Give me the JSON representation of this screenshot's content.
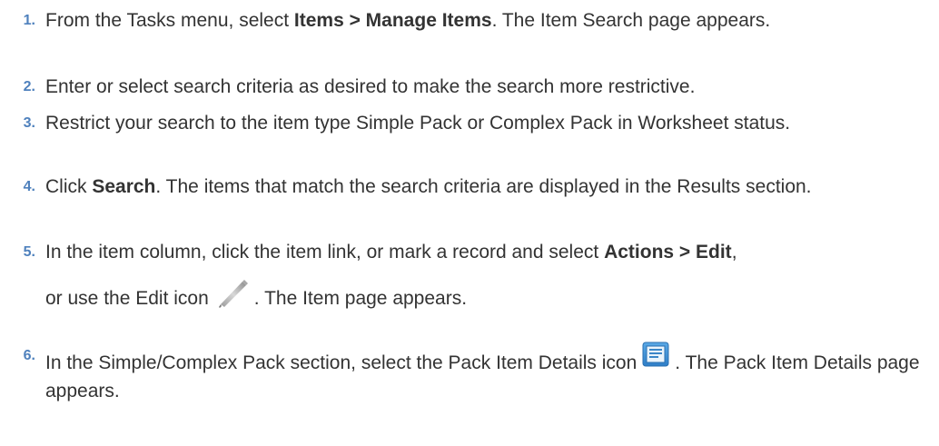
{
  "steps": [
    {
      "number": "1.",
      "before": "From the Tasks menu, select ",
      "bold": "Items > Manage Items",
      "after": ". The Item Search page appears."
    },
    {
      "number": "2.",
      "text": "Enter or select search criteria as desired to make the search more restrictive."
    },
    {
      "number": "3.",
      "text": "Restrict your search to the item type Simple Pack or Complex Pack in Worksheet status."
    },
    {
      "number": "4.",
      "before": "Click ",
      "bold": "Search",
      "after": ". The items that match the search criteria are displayed in the Results section."
    },
    {
      "number": "5.",
      "before": "In the item column, click the item link, or mark a record and select ",
      "bold": "Actions > Edit",
      "after": ",",
      "line2_before": "or use the Edit icon",
      "line2_after": ". The Item page appears."
    },
    {
      "number": "6.",
      "before": "In the Simple/Complex Pack section, select the Pack Item Details icon",
      "after": ". The Pack Item Details page appears."
    }
  ],
  "icons": {
    "edit": "pencil-icon",
    "pack_item_details": "details-icon",
    "accent_color": "#4f81bd"
  }
}
